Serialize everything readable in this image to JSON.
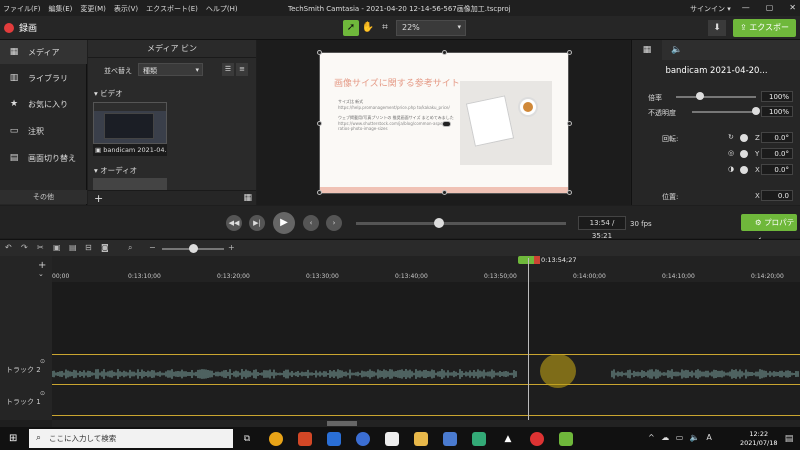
{
  "titlebar": {
    "menus": [
      "ファイル(F)",
      "編集(E)",
      "変更(M)",
      "表示(V)",
      "エクスポート(E)",
      "ヘルプ(H)"
    ],
    "title": "TechSmith Camtasia - 2021-04-20 12-14-56-567画像加工.tscproj",
    "signin": "サインイン ▾",
    "min": "—",
    "max": "▢",
    "close": "✕"
  },
  "toolbar": {
    "record_label": "録画",
    "zoom_value": "22%",
    "export_label": "エクスポート"
  },
  "leftnav": {
    "items": [
      {
        "label": "メディア",
        "icon": "media-icon",
        "glyph": "▦"
      },
      {
        "label": "ライブラリ",
        "icon": "library-icon",
        "glyph": "▥"
      },
      {
        "label": "お気に入り",
        "icon": "star-icon",
        "glyph": "★"
      },
      {
        "label": "注釈",
        "icon": "annotation-icon",
        "glyph": "▭"
      },
      {
        "label": "画面切り替え",
        "icon": "transition-icon",
        "glyph": "▤"
      }
    ],
    "other_label": "その他"
  },
  "media": {
    "header": "メディア ビン",
    "sort_label": "並べ替え",
    "sort_value": "種類",
    "video_section": "ビデオ",
    "clip_name": "bandicam 2021-04...",
    "audio_section": "オーディオ"
  },
  "slide": {
    "title": "画像サイズに関する参考サイト",
    "line1": "サイズ比 新式",
    "url1": "https://help.promanagement/price.php to/kakaku_price/",
    "line2": "ウェブ掲載用/写真プリントの 推奨画面サイズ まとめてみました",
    "url2": "https://www.shutterstock.com/ja/blog/common-aspect-ratios-photo-image-sizes"
  },
  "props": {
    "clip_name": "bandicam 2021-04-20...",
    "scale_label": "倍率",
    "scale_value": "100%",
    "scale_level": 0.3,
    "opacity_label": "不透明度",
    "opacity_value": "100%",
    "opacity_level": 1.0,
    "rotation_label": "回転:",
    "rot_z_label": "Z",
    "rot_z": "0.0°",
    "rot_y_label": "Y",
    "rot_y": "0.0°",
    "rot_x_label": "X",
    "rot_x": "0.0°",
    "position_label": "位置:",
    "pos_x_label": "X",
    "pos_x": "0.0"
  },
  "playback": {
    "timecode": "13:54 / 35:21",
    "fps": "30 fps",
    "scrub_fraction": 0.393,
    "properties_label": "プロパティ"
  },
  "timeline": {
    "playhead_label": "0:13:54;27",
    "ticks": [
      "00;00",
      "0:13:10;00",
      "0:13:20;00",
      "0:13:30;00",
      "0:13:40;00",
      "0:13:50;00",
      "0:14:00;00",
      "0:14:10;00",
      "0:14:20;00"
    ],
    "track2": "トラック 2",
    "track1": "トラック 1"
  },
  "taskbar": {
    "search_placeholder": "ここに入力して検索",
    "time": "12:22",
    "date": "2021/07/18",
    "ime": "A"
  }
}
